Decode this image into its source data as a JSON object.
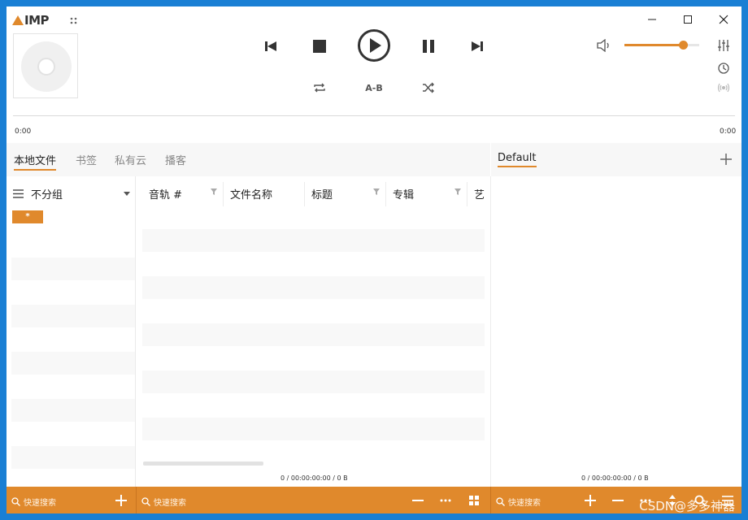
{
  "app": {
    "logo_text": "IMP",
    "accent": "#e0892c"
  },
  "window_controls": [
    "minimize",
    "maximize",
    "close"
  ],
  "player": {
    "ab_label": "A-B",
    "time_elapsed": "0:00",
    "time_total": "0:00",
    "volume_fraction": 0.79
  },
  "library_tabs": [
    {
      "label": "本地文件",
      "active": true
    },
    {
      "label": "书签",
      "active": false
    },
    {
      "label": "私有云",
      "active": false
    },
    {
      "label": "播客",
      "active": false
    }
  ],
  "grouping": {
    "label": "不分组",
    "badge": "*"
  },
  "columns": [
    "音轨 #",
    "文件名称",
    "标题",
    "专辑",
    "艺"
  ],
  "library_stats": "0 / 00:00:00:00 / 0 B",
  "playlist": {
    "tab_label": "Default",
    "stats": "0 / 00:00:00:00 / 0 B"
  },
  "search": {
    "groups_placeholder": "快速搜索",
    "library_placeholder": "快速搜索",
    "playlist_placeholder": "快速搜索"
  },
  "watermark": "CSDN@多多神器"
}
